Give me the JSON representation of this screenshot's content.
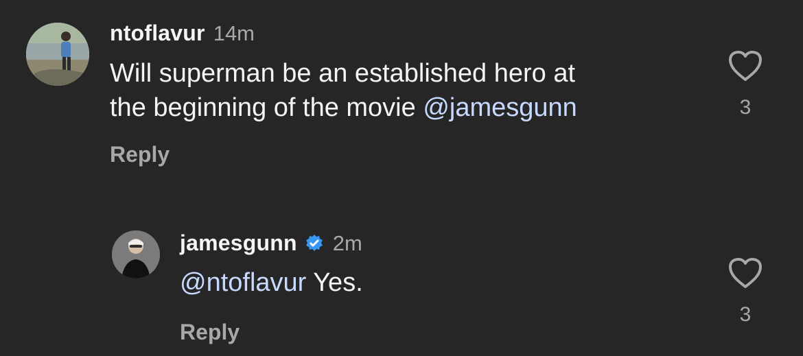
{
  "comments": [
    {
      "username": "ntoflavur",
      "time": "14m",
      "verified": false,
      "text_prefix": "Will superman be an established hero at\nthe beginning of the movie ",
      "mention": "@jamesgunn",
      "text_suffix": "",
      "reply_label": "Reply",
      "like_count": "3",
      "icons": {
        "avatar": "avatar-photo",
        "like": "heart-icon"
      }
    },
    {
      "username": "jamesgunn",
      "time": "2m",
      "verified": true,
      "text_prefix": "",
      "mention": "@ntoflavur",
      "text_suffix": " Yes.",
      "reply_label": "Reply",
      "like_count": "3",
      "icons": {
        "avatar": "avatar-photo",
        "verified": "verified-badge-icon",
        "like": "heart-icon"
      }
    }
  ],
  "colors": {
    "background": "#262626",
    "primary_text": "#f5f5f5",
    "secondary_text": "#a8a8a8",
    "mention": "#c7d9ff",
    "verified_badge": "#3897f0"
  }
}
